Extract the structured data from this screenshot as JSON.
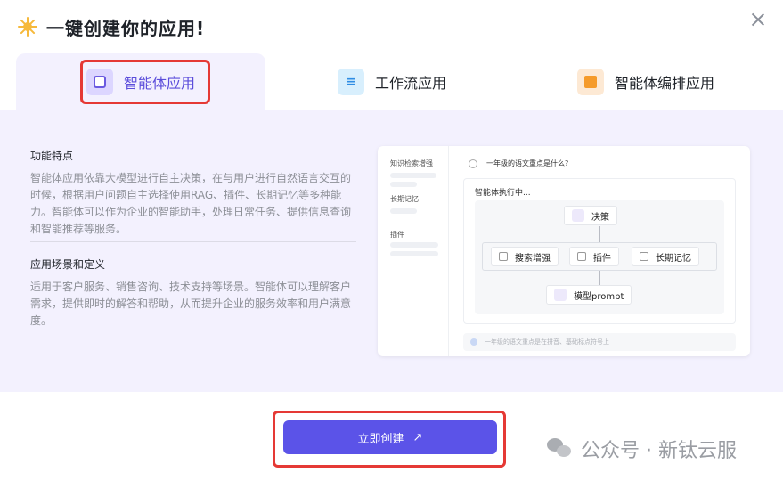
{
  "header": {
    "title": "一键创建你的应用!"
  },
  "tabs": [
    {
      "label": "智能体应用"
    },
    {
      "label": "工作流应用"
    },
    {
      "label": "智能体编排应用"
    }
  ],
  "features": {
    "heading": "功能特点",
    "text": "智能体应用依靠大模型进行自主决策，在与用户进行自然语言交互的时候，根据用户问题自主选择使用RAG、插件、长期记忆等多种能力。智能体可以作为企业的智能助手，处理日常任务、提供信息查询和智能推荐等服务。"
  },
  "scenarios": {
    "heading": "应用场景和定义",
    "text": "适用于客户服务、销售咨询、技术支持等场景。智能体可以理解客户需求，提供即时的解答和帮助，从而提升企业的服务效率和用户满意度。"
  },
  "preview": {
    "side_items": [
      "知识检索增强",
      "长期记忆",
      "插件"
    ],
    "question": "一年级的语文重点是什么?",
    "running": "智能体执行中...",
    "node_decision": "决策",
    "node_search": "搜索增强",
    "node_plugin": "插件",
    "node_memory": "长期记忆",
    "node_model": "模型prompt",
    "footer": "一年级的语文重点是在拼音、基础标点符号上"
  },
  "footer": {
    "create_label": "立即创建",
    "watermark": "公众号 · 新钛云服"
  },
  "colors": {
    "accent": "#5b53e8",
    "highlight": "#e53935",
    "panel": "#f3f1fe"
  }
}
